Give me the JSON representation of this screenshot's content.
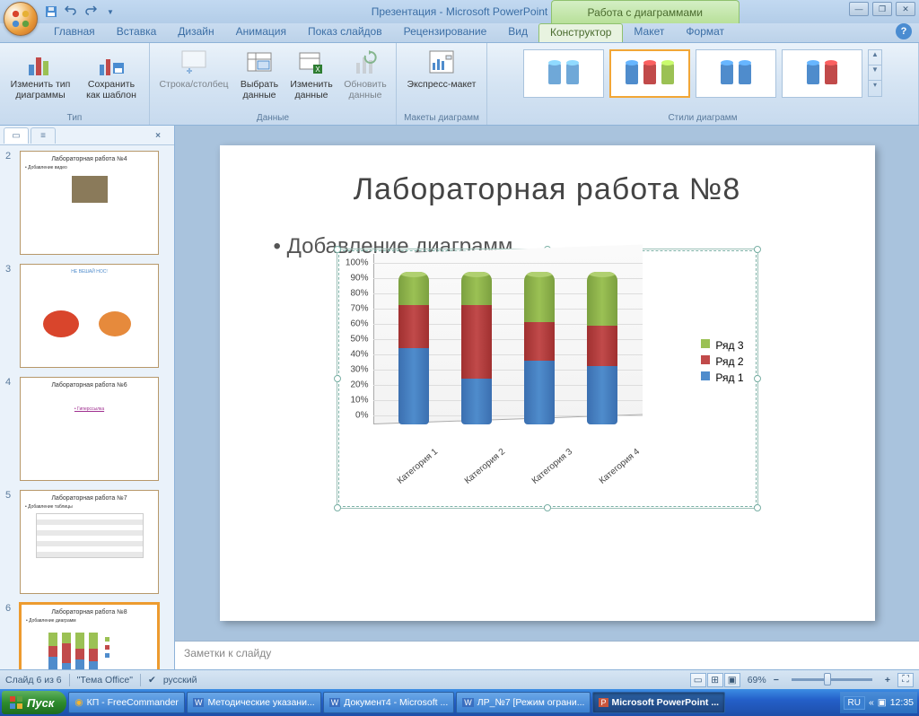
{
  "title": "Презентация - Microsoft PowerPoint",
  "context_title": "Работа с диаграммами",
  "tabs": {
    "home": "Главная",
    "insert": "Вставка",
    "design": "Дизайн",
    "animation": "Анимация",
    "slideshow": "Показ слайдов",
    "review": "Рецензирование",
    "view": "Вид",
    "chart_design": "Конструктор",
    "chart_layout": "Макет",
    "chart_format": "Формат"
  },
  "ribbon": {
    "type_group": "Тип",
    "change_type": "Изменить тип диаграммы",
    "save_template": "Сохранить как шаблон",
    "data_group": "Данные",
    "switch_rc": "Строка/столбец",
    "select_data": "Выбрать данные",
    "edit_data": "Изменить данные",
    "refresh_data": "Обновить данные",
    "layouts_group": "Макеты диаграмм",
    "express_layout": "Экспресс-макет",
    "styles_group": "Стили диаграмм"
  },
  "slides": [
    {
      "num": "2",
      "title": "Лабораторная работа №4"
    },
    {
      "num": "3",
      "title": ""
    },
    {
      "num": "4",
      "title": "Лабораторная работа №6"
    },
    {
      "num": "5",
      "title": "Лабораторная работа №7"
    },
    {
      "num": "6",
      "title": "Лабораторная работа №8"
    }
  ],
  "current_slide": {
    "title": "Лабораторная работа №8",
    "bullet": "Добавление диаграмм"
  },
  "chart_data": {
    "type": "bar",
    "stacked": true,
    "percent": true,
    "categories": [
      "Категория 1",
      "Категория 2",
      "Категория 3",
      "Категория 4"
    ],
    "series": [
      {
        "name": "Ряд 1",
        "color": "#4f8ccc",
        "values": [
          50,
          30,
          42,
          38
        ]
      },
      {
        "name": "Ряд 2",
        "color": "#c14a4a",
        "values": [
          28,
          48,
          25,
          27
        ]
      },
      {
        "name": "Ряд 3",
        "color": "#9bc154",
        "values": [
          22,
          22,
          33,
          35
        ]
      }
    ],
    "ylim": [
      0,
      100
    ],
    "yticks": [
      "0%",
      "10%",
      "20%",
      "30%",
      "40%",
      "50%",
      "60%",
      "70%",
      "80%",
      "90%",
      "100%"
    ]
  },
  "notes_placeholder": "Заметки к слайду",
  "status": {
    "slide_pos": "Слайд 6 из 6",
    "theme": "\"Тема Office\"",
    "language": "русский",
    "zoom": "69%"
  },
  "taskbar": {
    "start": "Пуск",
    "items": [
      "КП - FreeCommander",
      "Методические указани...",
      "Документ4 - Microsoft ...",
      "ЛР_№7 [Режим ограни...",
      "Microsoft PowerPoint ..."
    ],
    "lang": "RU",
    "time": "12:35"
  }
}
